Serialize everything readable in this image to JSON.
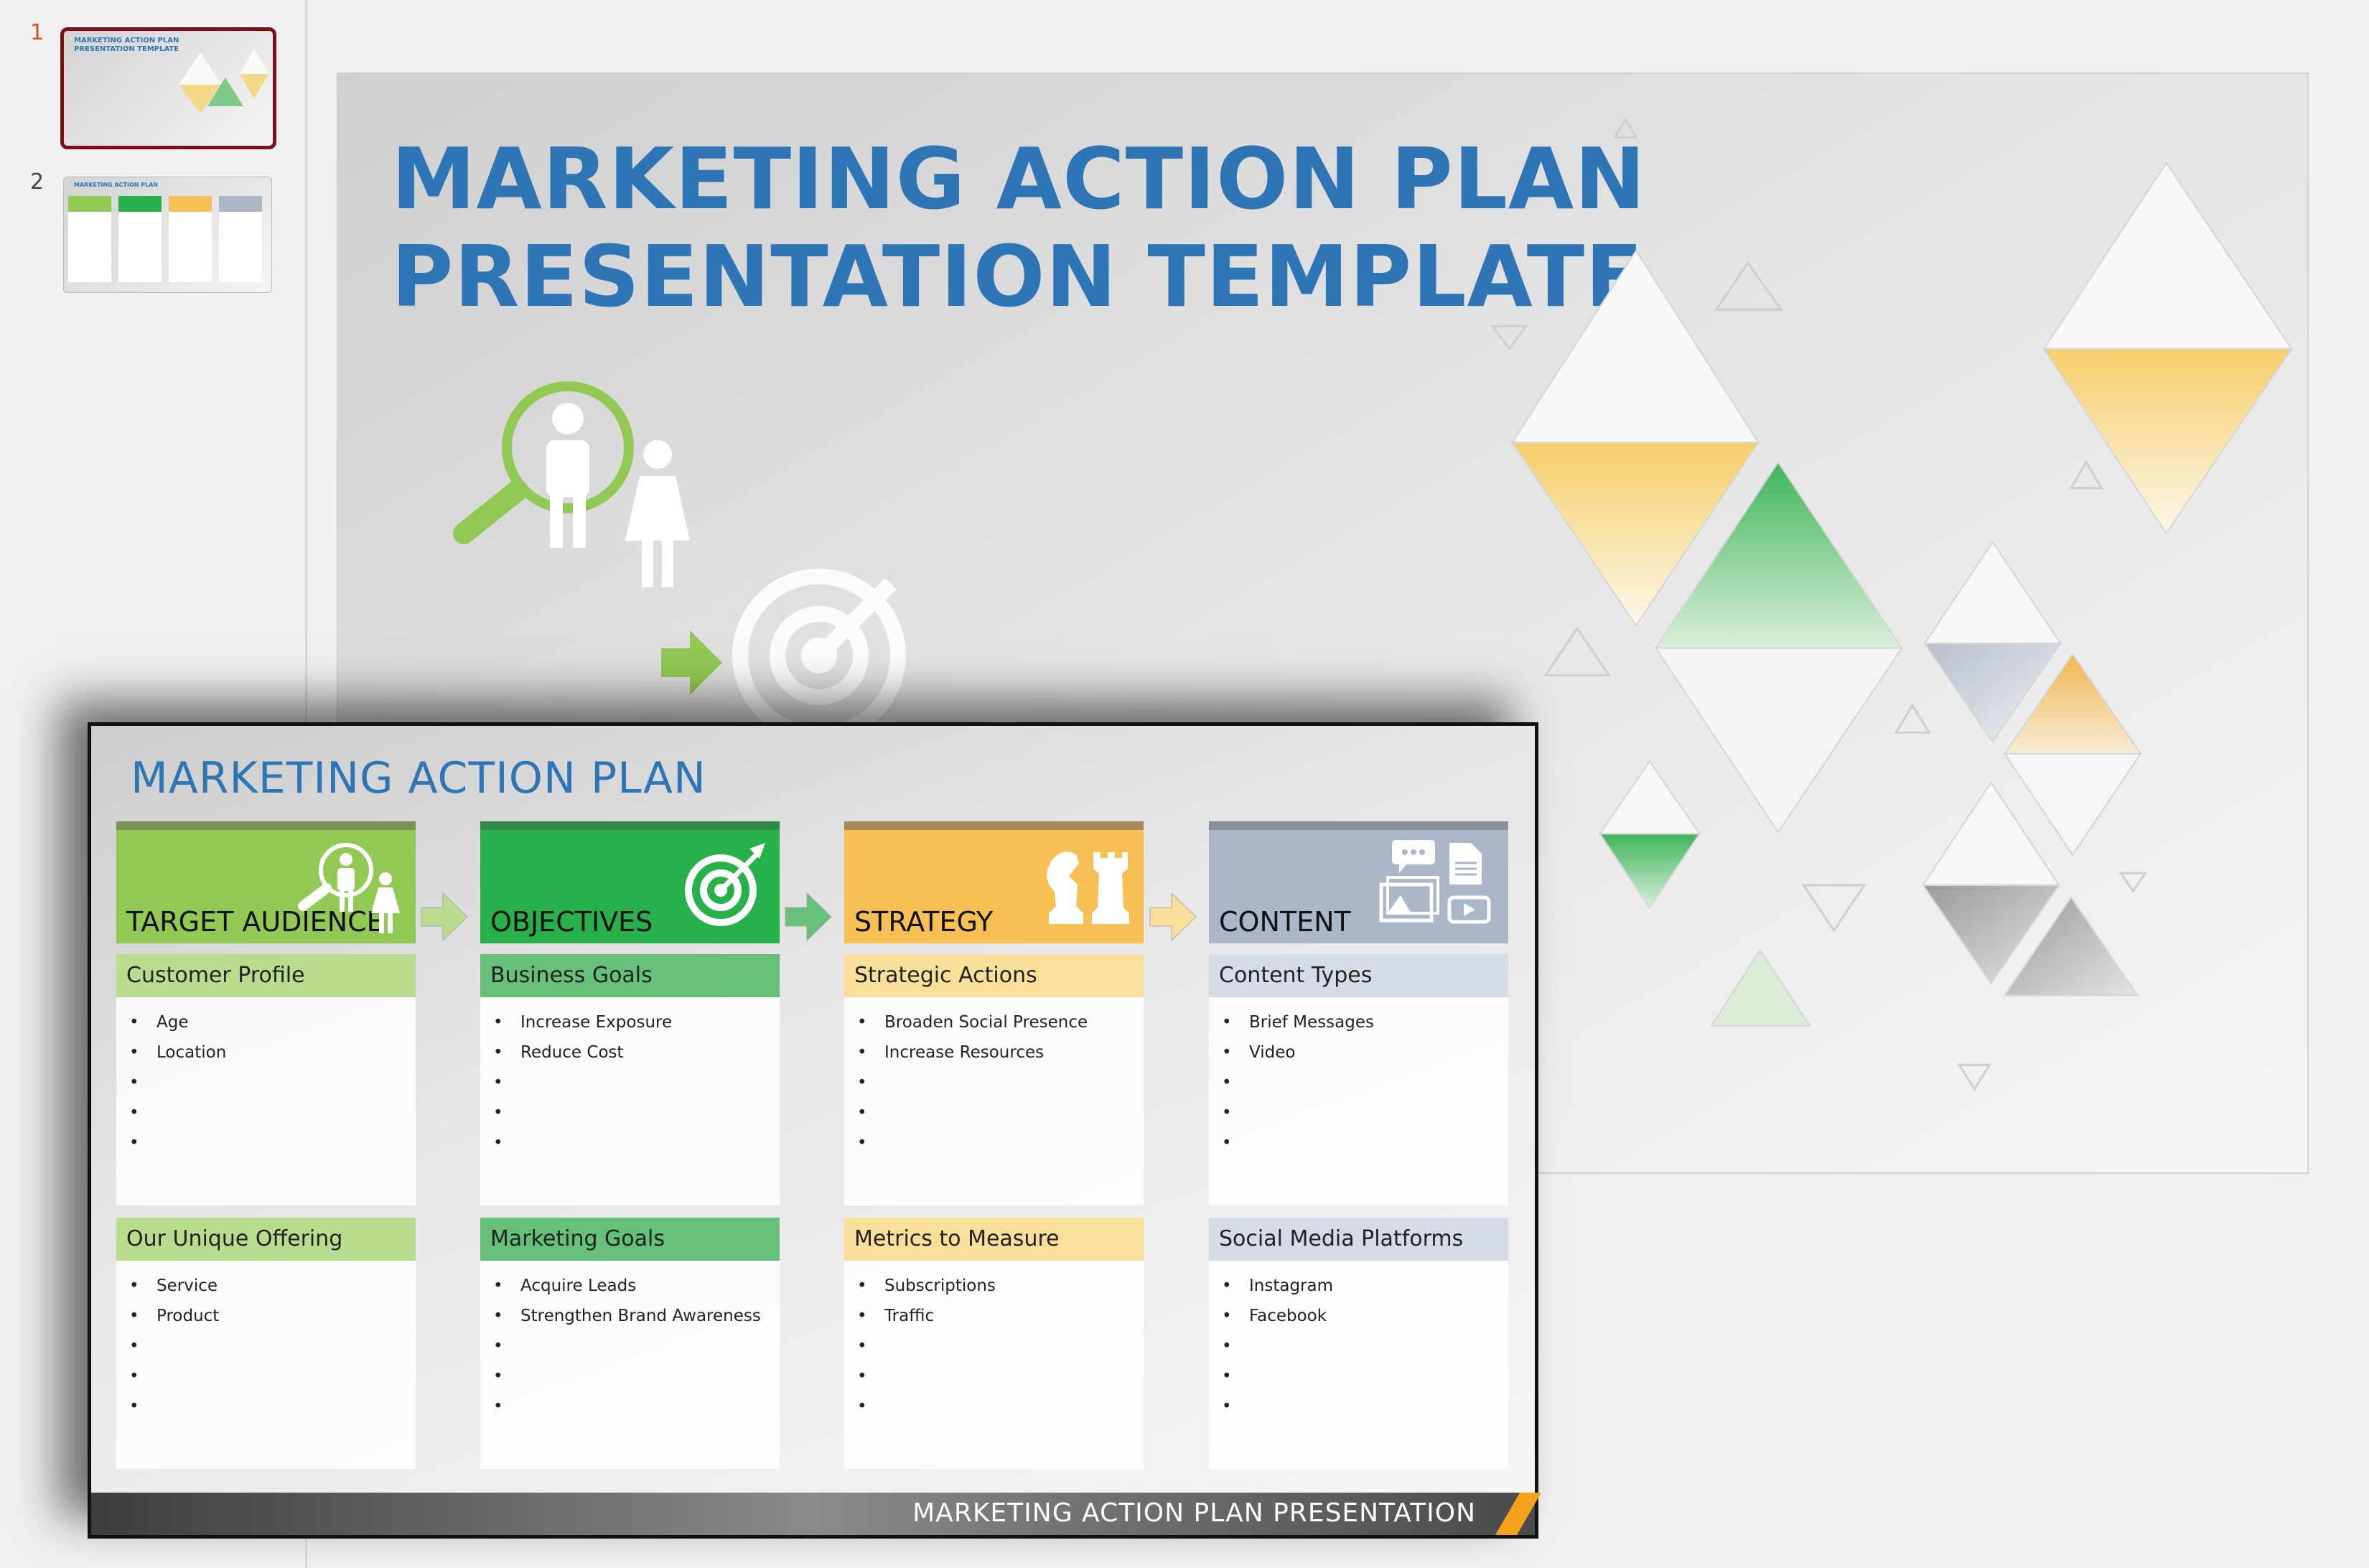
{
  "thumbnails": [
    {
      "number": "1",
      "title_line1": "MARKETING ACTION PLAN",
      "title_line2": "PRESENTATION TEMPLATE",
      "selected": true
    },
    {
      "number": "2",
      "title_line1": "MARKETING ACTION PLAN",
      "selected": false
    }
  ],
  "slide1": {
    "title_line1": "MARKETING ACTION PLAN",
    "title_line2": "PRESENTATION TEMPLATE",
    "icons": [
      "magnifier-person-icon",
      "woman-icon",
      "arrow-right-icon",
      "target-icon"
    ]
  },
  "slide2": {
    "title": "MARKETING ACTION PLAN",
    "footer": "MARKETING ACTION PLAN PRESENTATION",
    "columns": [
      {
        "label": "TARGET AUDIENCE",
        "icon": "audience-search-icon",
        "color": "#92c954",
        "bar": "#7a9456",
        "sub_color": "#b9dc8e",
        "sections": [
          {
            "title": "Customer Profile",
            "items": [
              "Age",
              "Location",
              "",
              "",
              ""
            ]
          },
          {
            "title": "Our Unique Offering",
            "items": [
              "Service",
              "Product",
              "",
              "",
              ""
            ]
          }
        ]
      },
      {
        "label": "OBJECTIVES",
        "icon": "target-icon",
        "color": "#28b04a",
        "bar": "#2e8a47",
        "sub_color": "#66c07a",
        "sections": [
          {
            "title": "Business Goals",
            "items": [
              "Increase Exposure",
              "Reduce Cost",
              "",
              "",
              ""
            ]
          },
          {
            "title": "Marketing Goals",
            "items": [
              "Acquire Leads",
              "Strengthen Brand Awareness",
              "",
              "",
              ""
            ]
          }
        ]
      },
      {
        "label": "STRATEGY",
        "icon": "chess-icon",
        "color": "#f8bf55",
        "bar": "#a8875a",
        "sub_color": "#f9df9a",
        "sections": [
          {
            "title": "Strategic Actions",
            "items": [
              "Broaden Social Presence",
              "Increase Resources",
              "",
              "",
              ""
            ]
          },
          {
            "title": "Metrics to Measure",
            "items": [
              "Subscriptions",
              "Traffic",
              "",
              "",
              ""
            ]
          }
        ]
      },
      {
        "label": "CONTENT",
        "icon": "media-content-icon",
        "color": "#abb6c8",
        "bar": "#87909c",
        "sub_color": "#d5dce6",
        "sections": [
          {
            "title": "Content Types",
            "items": [
              "Brief Messages",
              "Video",
              "",
              "",
              ""
            ]
          },
          {
            "title": "Social Media Platforms",
            "items": [
              "Instagram",
              "Facebook",
              "",
              "",
              ""
            ]
          }
        ]
      }
    ],
    "arrow_colors": [
      "#b9dc8e",
      "#66c07a",
      "#f9df9a"
    ]
  },
  "colors": {
    "title_blue": "#2e75b6",
    "selected_border": "#7a1215",
    "footer_accent": "#f4a21c"
  }
}
